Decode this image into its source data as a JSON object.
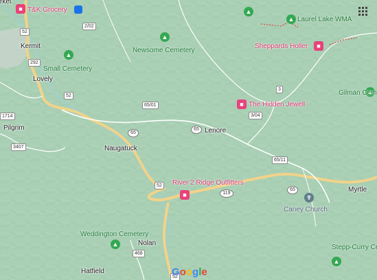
{
  "map": {
    "colors": {
      "terrain": "#a9cfb4",
      "highway": "#f1d38a",
      "road": "#ffffff",
      "water": "#9ecfd9",
      "business_pin": "#e8437a",
      "park_pin": "#34a853"
    },
    "places": {
      "kermit": "Kermit",
      "lovely": "Lovely",
      "pilgrim": "Pilgrim",
      "naugatuck": "Naugatuck",
      "lenore": "Lenore",
      "nolan": "Nolan",
      "hatfield": "Hatfield",
      "myrtle": "Myrtle"
    },
    "parks": {
      "small_cemetery": "Small Cemetery",
      "newsome_cemetery": "Newsome Cemetery",
      "laurel_lake": "Laurel Lake WMA",
      "weddington_cemetery": "Weddington Cemetery"
    },
    "partial_labels": {
      "market_partial": "rket",
      "gilman_partial": "Gilman Cem",
      "stepp_curry_partial": "Stepp-Curry Ce"
    },
    "businesses": {
      "tk_grocery": "T&K Grocery",
      "sheppards_holler": "Sheppards Holler",
      "hidden_jewell": "The Hidden Jewell",
      "river2ridge": "River 2 Ridge Outfitters"
    },
    "churches": {
      "caney": "Caney Church"
    },
    "route_shields": {
      "r52_a": "52",
      "r2_02": "2/02",
      "r292": "292",
      "r52_b": "52",
      "r1714": "1714",
      "r3407": "3407",
      "r65_01": "65/01",
      "r65_a": "65",
      "r65_b": "65",
      "r3": "3",
      "r3_04": "3/04",
      "r65_11": "65/11",
      "r52_c": "52",
      "r119": "119",
      "r65_c": "65",
      "r468": "468",
      "r52_d": "52"
    },
    "icons": {
      "apps": "apps-grid-icon",
      "park": "park-tree-icon",
      "business": "bed-icon",
      "church": "church-cross-icon"
    },
    "logo": [
      "G",
      "o",
      "o",
      "g",
      "l",
      "e"
    ]
  }
}
